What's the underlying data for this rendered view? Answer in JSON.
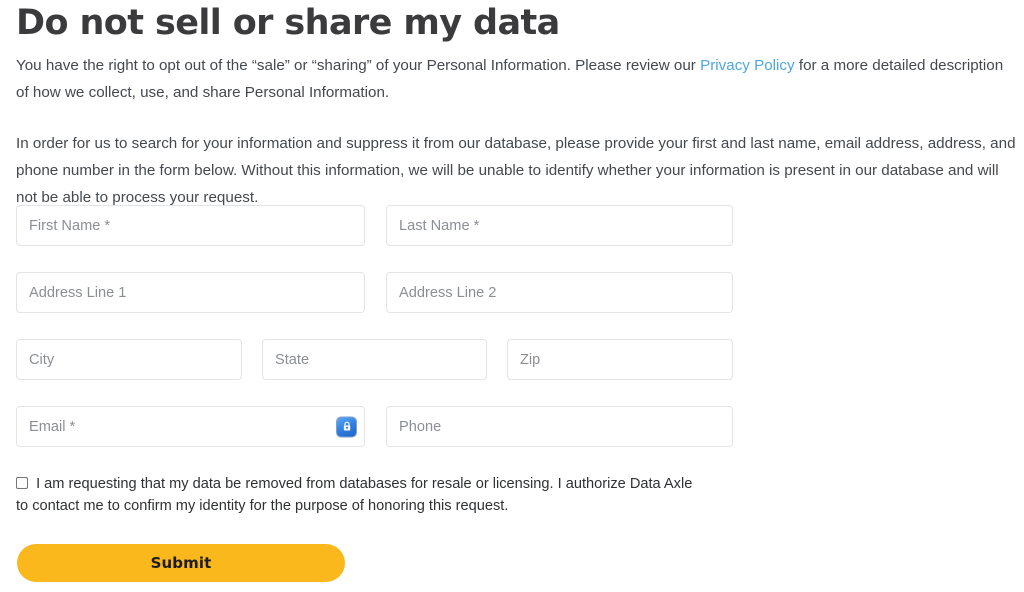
{
  "page": {
    "title": "Do not sell or share my data",
    "intro": {
      "paragraph1_before_link": "You have the right to opt out of the “sale” or “sharing” of your Personal Information. Please review our ",
      "link_text": "Privacy Policy",
      "paragraph1_after_link": " for a more detailed description of how we collect, use, and share Personal Information.",
      "paragraph2": "In order for us to search for your information and suppress it from our database, please provide your first and last name, email address, address, and phone number in the form below. Without this information, we will be unable to identify whether your information is present in our database and will not be able to process your request."
    }
  },
  "form": {
    "fields": {
      "first_name": {
        "placeholder": "First Name *",
        "value": ""
      },
      "last_name": {
        "placeholder": "Last Name *",
        "value": ""
      },
      "address_line_1": {
        "placeholder": "Address Line 1",
        "value": ""
      },
      "address_line_2": {
        "placeholder": "Address Line 2",
        "value": ""
      },
      "city": {
        "placeholder": "City",
        "value": ""
      },
      "state": {
        "placeholder": "State",
        "value": ""
      },
      "zip": {
        "placeholder": "Zip",
        "value": ""
      },
      "email": {
        "placeholder": "Email *",
        "value": "",
        "icon": "padlock-autofill-icon"
      },
      "phone": {
        "placeholder": "Phone",
        "value": ""
      }
    },
    "consent": {
      "checked": false,
      "label": "I am requesting that my data be removed from databases for resale or licensing. I authorize Data Axle to contact me to confirm my identity for the purpose of honoring this request."
    },
    "submit_label": "Submit"
  },
  "colors": {
    "heading": "#3b3b3d",
    "body_text": "#45494d",
    "link": "#4ea6e4",
    "placeholder": "#8b8f94",
    "field_border": "#e2e4e6",
    "submit_background": "#fbb81c",
    "submit_text": "#1d1d1f",
    "autofill_icon": "#2f7fe0"
  }
}
